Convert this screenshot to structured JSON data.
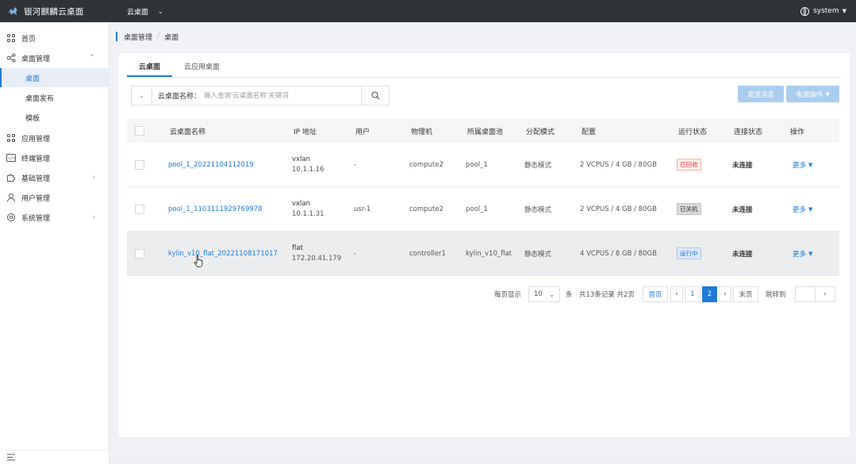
{
  "app": {
    "brand": "银河麒麟云桌面",
    "top_menu": "云桌面",
    "user": "system"
  },
  "sidebar": {
    "items": [
      {
        "label": "首页"
      },
      {
        "label": "桌面管理"
      },
      {
        "label": "桌面"
      },
      {
        "label": "桌面发布"
      },
      {
        "label": "模板"
      },
      {
        "label": "应用管理"
      },
      {
        "label": "终端管理"
      },
      {
        "label": "基础管理"
      },
      {
        "label": "用户管理"
      },
      {
        "label": "系统管理"
      }
    ]
  },
  "breadcrumb": {
    "parent": "桌面管理",
    "current": "桌面"
  },
  "tabs": [
    "云桌面",
    "云应用桌面"
  ],
  "search": {
    "label": "云桌面名称：",
    "placeholder": "输入查询'云桌面名称'关键词"
  },
  "actions": {
    "send_message": "发送消息",
    "power_ops": "电源操作"
  },
  "table": {
    "headers": [
      "云桌面名称",
      "IP 地址",
      "用户",
      "物理机",
      "所属桌面池",
      "分配模式",
      "配置",
      "运行状态",
      "连接状态",
      "操作"
    ],
    "rows": [
      {
        "name": "pool_1_20221104112019",
        "net": "vxlan",
        "ip": "10.1.1.16",
        "user": "-",
        "host": "compute2",
        "pool": "pool_1",
        "mode": "静态模式",
        "config": "2 VCPUS / 4 GB / 80GB",
        "status": "已回收",
        "conn": "未连接",
        "op": "更多"
      },
      {
        "name": "pool_1_1103111929769978",
        "net": "vxlan",
        "ip": "10.1.1.31",
        "user": "usr-1",
        "host": "compute2",
        "pool": "pool_1",
        "mode": "静态模式",
        "config": "2 VCPUS / 4 GB / 80GB",
        "status": "已关机",
        "conn": "未连接",
        "op": "更多"
      },
      {
        "name": "kylin_v10_flat_20221108171017",
        "net": "flat",
        "ip": "172.20.41.179",
        "user": "-",
        "host": "controller1",
        "pool": "kylin_v10_flat",
        "mode": "静态模式",
        "config": "4 VCPUS / 8 GB / 80GB",
        "status": "运行中",
        "conn": "未连接",
        "op": "更多"
      }
    ]
  },
  "pagination": {
    "per_page_label": "每页显示",
    "per_page_value": "10",
    "unit": "条",
    "summary": "共13条记录 共2页",
    "first": "首页",
    "prev": "‹",
    "pages": [
      "1",
      "2"
    ],
    "next": "›",
    "last": "末页",
    "jump_label": "跳转到",
    "jump_next": "›"
  },
  "colors": {
    "accent": "#1e7bd6",
    "topbar": "#2f3336",
    "status_recycled": "#e0453a",
    "status_running": "#1e6fd0"
  }
}
